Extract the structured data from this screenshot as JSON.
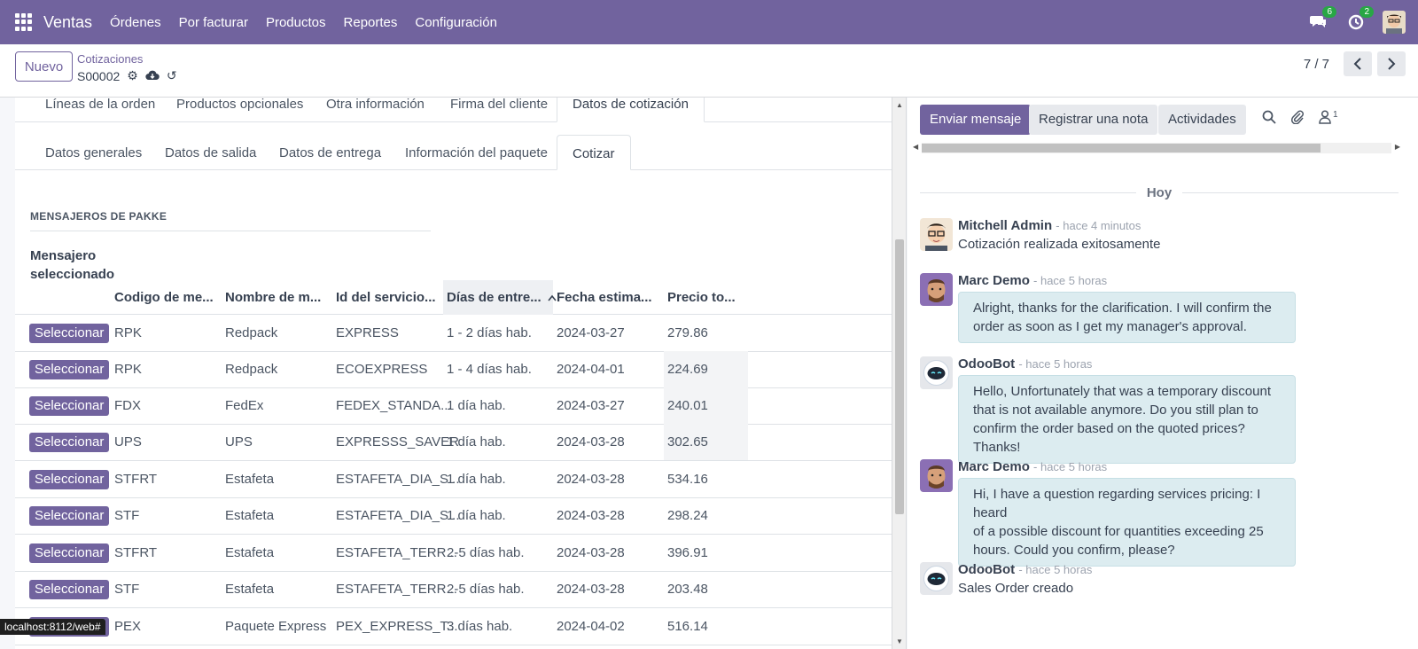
{
  "topnav": {
    "app_name": "Ventas",
    "menu": [
      "Órdenes",
      "Por facturar",
      "Productos",
      "Reportes",
      "Configuración"
    ],
    "messages_badge": "6",
    "activities_badge": "2"
  },
  "control": {
    "new_button": "Nuevo",
    "breadcrumb_parent": "Cotizaciones",
    "breadcrumb_current": "S00002",
    "pager": "7 / 7"
  },
  "form": {
    "tabs_main": [
      "Líneas de la orden",
      "Productos opcionales",
      "Otra información",
      "Firma del cliente",
      "Datos de cotización"
    ],
    "tabs_sub": [
      "Datos generales",
      "Datos de salida",
      "Datos de entrega",
      "Información del paquete",
      "Cotizar"
    ],
    "section_title": "MENSAJEROS DE PAKKE",
    "field_label": "Mensajero seleccionado",
    "columns": [
      "Codigo de me...",
      "Nombre de m...",
      "Id del servicio...",
      "Días de entre...",
      "Fecha estima...",
      "Precio to..."
    ],
    "select_label": "Seleccionar",
    "rows": [
      [
        "RPK",
        "Redpack",
        "EXPRESS",
        "1 - 2 días hab.",
        "2024-03-27",
        "279.86"
      ],
      [
        "RPK",
        "Redpack",
        "ECOEXPRESS",
        "1 - 4 días hab.",
        "2024-04-01",
        "224.69"
      ],
      [
        "FDX",
        "FedEx",
        "FEDEX_STANDA...",
        "1 día hab.",
        "2024-03-27",
        "240.01"
      ],
      [
        "UPS",
        "UPS",
        "EXPRESSS_SAVER",
        "1 día hab.",
        "2024-03-28",
        "302.65"
      ],
      [
        "STFRT",
        "Estafeta",
        "ESTAFETA_DIA_S...",
        "1 día hab.",
        "2024-03-28",
        "534.16"
      ],
      [
        "STF",
        "Estafeta",
        "ESTAFETA_DIA_S...",
        "1 día hab.",
        "2024-03-28",
        "298.24"
      ],
      [
        "STFRT",
        "Estafeta",
        "ESTAFETA_TERR...",
        "2-5 días hab.",
        "2024-03-28",
        "396.91"
      ],
      [
        "STF",
        "Estafeta",
        "ESTAFETA_TERR...",
        "2-5 días hab.",
        "2024-03-28",
        "203.48"
      ],
      [
        "PEX",
        "Paquete Express",
        "PEX_EXPRESS_T...",
        "3 días hab.",
        "2024-04-02",
        "516.14"
      ]
    ]
  },
  "chatter": {
    "send_message": "Enviar mensaje",
    "log_note": "Registrar una nota",
    "activities": "Actividades",
    "followers_count": "1",
    "day_divider": "Hoy",
    "messages": [
      {
        "author": "Mitchell Admin",
        "time": "- hace 4 minutos",
        "text": "Cotización realizada exitosamente"
      },
      {
        "author": "Marc Demo",
        "time": "- hace 5 horas",
        "lines": [
          "Alright, thanks for the clarification. I will confirm the",
          "order as soon as I get my manager's approval."
        ]
      },
      {
        "author": "OdooBot",
        "time": "- hace 5 horas",
        "lines": [
          "Hello, Unfortunately that was a temporary discount",
          "that is not available anymore. Do you still plan to",
          "confirm the order based on the quoted prices? Thanks!"
        ]
      },
      {
        "author": "Marc Demo",
        "time": "- hace 5 horas",
        "lines": [
          "Hi, I have a question regarding services pricing: I heard",
          "of a possible discount for quantities exceeding 25",
          "hours. Could you confirm, please?"
        ]
      },
      {
        "author": "OdooBot",
        "time": "- hace 5 horas",
        "text": "Sales Order creado"
      }
    ]
  },
  "status_url": "localhost:8112/web#"
}
